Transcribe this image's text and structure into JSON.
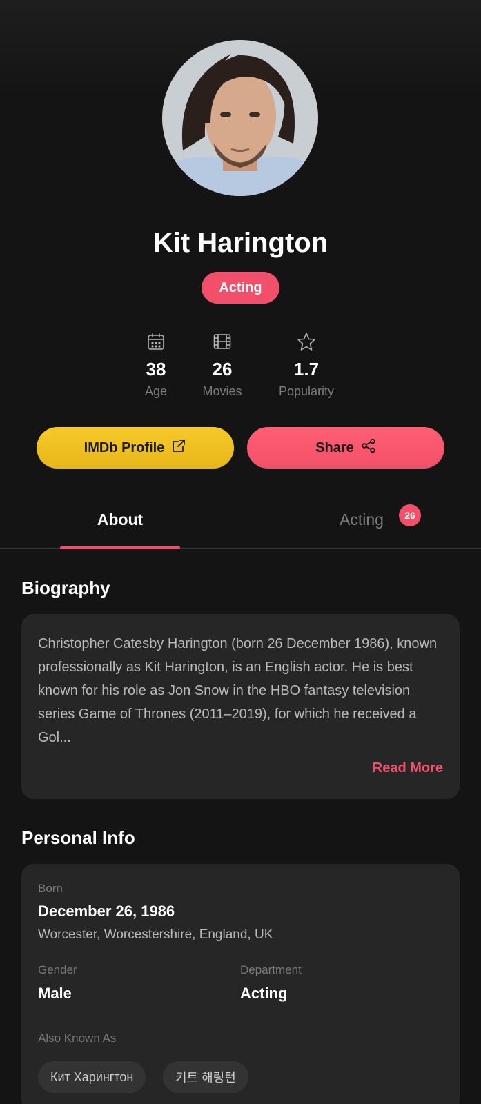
{
  "profile": {
    "name": "Kit Harington",
    "department": "Acting"
  },
  "stats": [
    {
      "icon": "calendar-icon",
      "value": "38",
      "label": "Age"
    },
    {
      "icon": "film-icon",
      "value": "26",
      "label": "Movies"
    },
    {
      "icon": "star-icon",
      "value": "1.7",
      "label": "Popularity"
    }
  ],
  "actions": {
    "imdb_label": "IMDb Profile",
    "imdb_icon": "external-link-icon",
    "share_label": "Share",
    "share_icon": "share-icon"
  },
  "tabs": [
    {
      "label": "About",
      "active": true
    },
    {
      "label": "Acting",
      "active": false,
      "badge": "26"
    }
  ],
  "biography": {
    "title": "Biography",
    "text": "Christopher Catesby Harington (born 26 December 1986), known professionally as Kit Harington, is an English actor. He is best known for his role as Jon Snow in the HBO fantasy television series Game of Thrones (2011–2019), for which he received a Gol...",
    "read_more": "Read More"
  },
  "personal_info": {
    "title": "Personal Info",
    "born_label": "Born",
    "born_date": "December 26, 1986",
    "born_place": "Worcester, Worcestershire, England, UK",
    "gender_label": "Gender",
    "gender_value": "Male",
    "department_label": "Department",
    "department_value": "Acting",
    "aka_label": "Also Known As",
    "aka": [
      "Кит Харингтон",
      "키트 해링턴"
    ]
  },
  "colors": {
    "accent": "#f2506a",
    "imdb_yellow": "#f6c92a",
    "background": "#141414",
    "card": "#262626"
  }
}
